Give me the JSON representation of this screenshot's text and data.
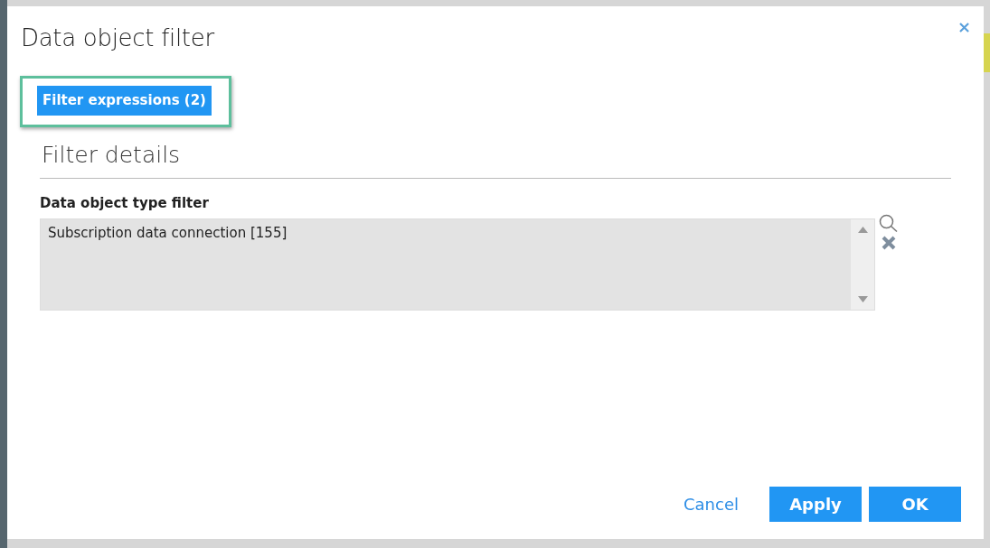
{
  "dialog": {
    "title": "Data object filter",
    "close_icon": "×"
  },
  "tabs": [
    {
      "label": "Filter expressions (2)",
      "selected": true
    }
  ],
  "section": {
    "heading": "Filter details"
  },
  "field": {
    "label": "Data object type filter",
    "value": "Subscription data connection [155]"
  },
  "buttons": [
    {
      "label": "Cancel",
      "kind": "link"
    },
    {
      "label": "Apply",
      "kind": "primary"
    },
    {
      "label": "OK",
      "kind": "primary"
    }
  ]
}
